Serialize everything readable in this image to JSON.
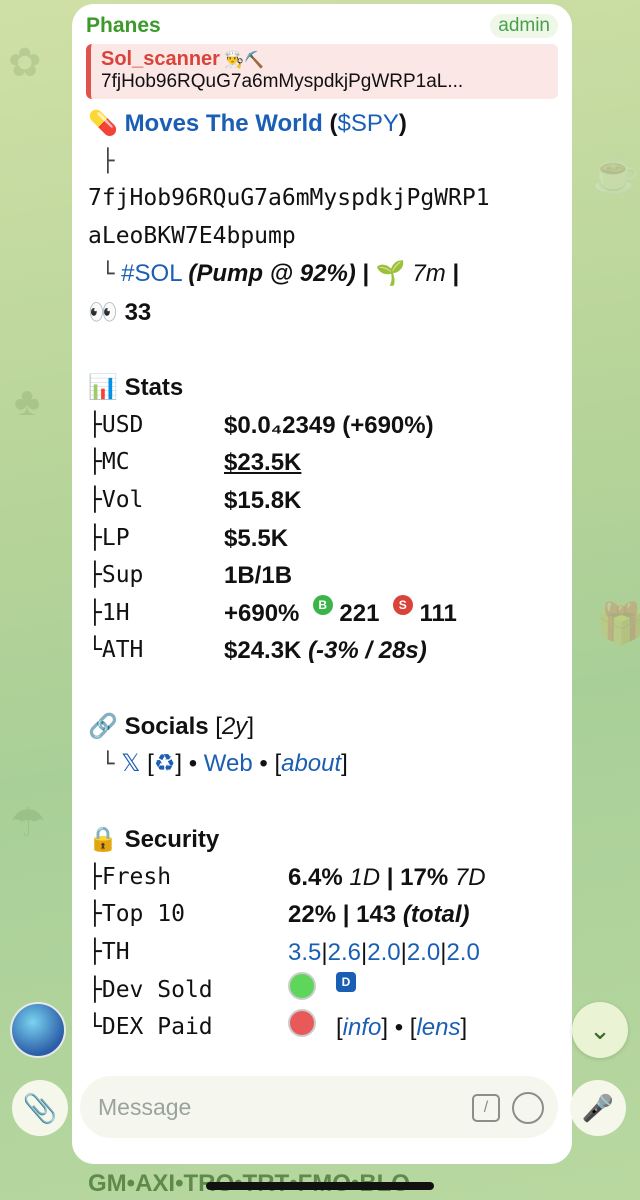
{
  "message": {
    "sender": "Phanes",
    "role": "admin",
    "reply": {
      "name": "Sol_scanner",
      "name_emoji": "👨‍🍳⛏️",
      "text": "7fjHob96RQuG7a6mMyspdkjPgWRP1aL..."
    },
    "token": {
      "icon": "💊",
      "name": "Moves The World",
      "ticker": "$SPY",
      "address_line1": "7fjHob96RQuG7a6mMyspdkjPgWRP1",
      "address_line2": "aLeoBKW7E4bpump",
      "chain": "#SOL",
      "pump_label": "Pump @",
      "pump_pct": "92%",
      "age_icon": "🌱",
      "age": "7m",
      "watchers_icon": "👀",
      "watchers": "33"
    },
    "stats": {
      "icon": "📊",
      "title": "Stats",
      "rows": [
        {
          "label": "USD",
          "value": "$0.0₄2349",
          "extra": "(+690%)"
        },
        {
          "label": "MC",
          "value": "$23.5K"
        },
        {
          "label": "Vol",
          "value": "$15.8K"
        },
        {
          "label": "LP",
          "value": "$5.5K"
        },
        {
          "label": "Sup",
          "value": "1B/1B"
        },
        {
          "label": "1H",
          "value": "+690%",
          "buys_badge": "B",
          "buys": "221",
          "sells_badge": "S",
          "sells": "111"
        },
        {
          "label": "ATH",
          "value": "$24.3K",
          "extra": "(-3% / 28s)"
        }
      ]
    },
    "socials": {
      "icon": "🔗",
      "title": "Socials",
      "age": "2y",
      "x_icon": "𝕏",
      "recycle_icon": "♻",
      "web": "Web",
      "about": "about"
    },
    "security": {
      "icon": "🔒",
      "title": "Security",
      "rows": [
        {
          "label": "Fresh",
          "value": "6.4%",
          "value_suffix": "1D",
          "value2": "17%",
          "value2_suffix": "7D"
        },
        {
          "label": "Top 10",
          "value": "22%",
          "value2": "143",
          "value2_suffix": "(total)"
        },
        {
          "label": "TH",
          "values": [
            "3.5",
            "2.6",
            "2.0",
            "2.0",
            "2.0"
          ]
        },
        {
          "label": "Dev Sold",
          "dev_badge": "D"
        },
        {
          "label": "DEX Paid",
          "info": "info",
          "lens": "lens"
        }
      ]
    }
  },
  "composer": {
    "placeholder": "Message",
    "command_icon": "/"
  },
  "keyboard_row": "GM•AXI•TRO•TRT•FMO•BLO",
  "colors": {
    "link": "#1a5fb4",
    "sender": "#3a9a2a",
    "reply_accent": "#e0534b"
  }
}
